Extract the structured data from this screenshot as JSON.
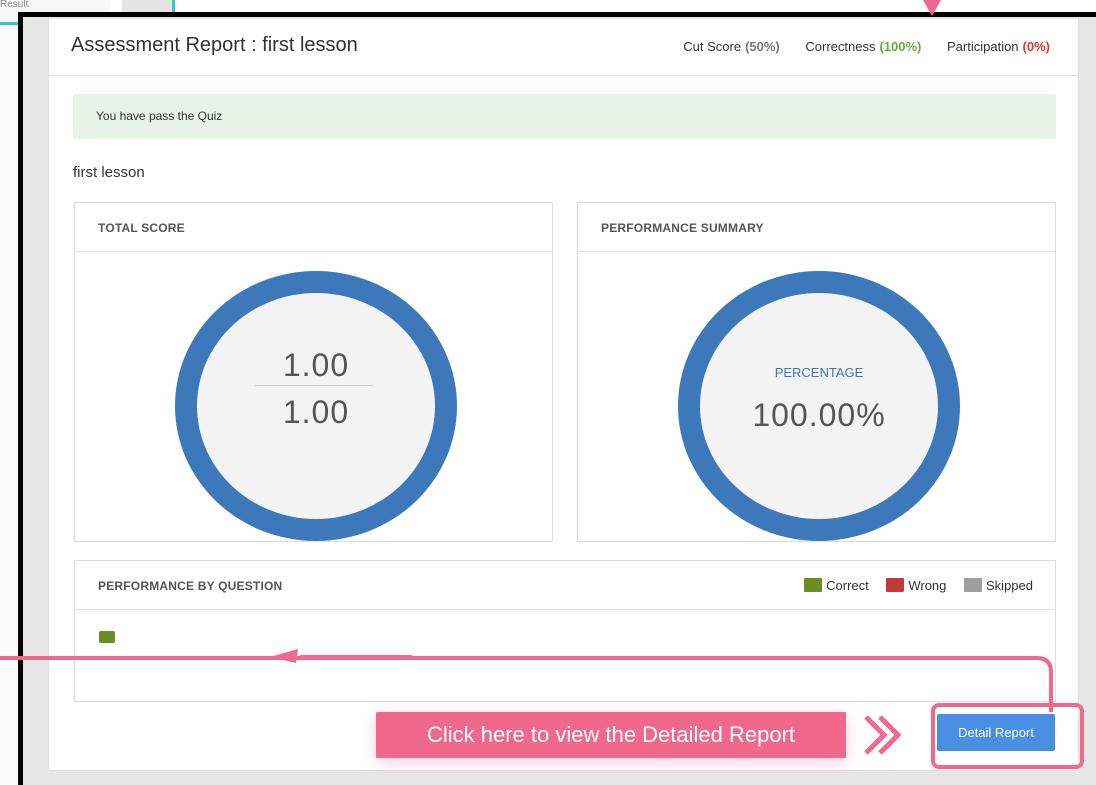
{
  "background": {
    "top_left_label": "Result"
  },
  "header": {
    "title": "Assessment Report : first lesson",
    "stats": [
      {
        "label": "Cut Score",
        "value": "(50%)"
      },
      {
        "label": "Correctness",
        "value": "(100%)"
      },
      {
        "label": "Participation",
        "value": "(0%)"
      }
    ]
  },
  "banner": {
    "message": "You have pass the Quiz"
  },
  "lesson": {
    "name": "first lesson"
  },
  "total_score": {
    "title": "TOTAL SCORE",
    "obtained": "1.00",
    "total": "1.00"
  },
  "performance_summary": {
    "title": "PERFORMANCE SUMMARY",
    "label": "PERCENTAGE",
    "value": "100.00%"
  },
  "performance_by_question": {
    "title": "PERFORMANCE BY QUESTION",
    "legend": [
      {
        "label": "Correct",
        "color": "#6b8e23"
      },
      {
        "label": "Wrong",
        "color": "#c0393b"
      },
      {
        "label": "Skipped",
        "color": "#9e9e9e"
      }
    ],
    "question_statuses": [
      "correct"
    ]
  },
  "actions": {
    "detail_report_label": "Detail Report"
  },
  "tutorial": {
    "callout_text": "Click here to view the Detailed Report",
    "highlight_color": "#f0688c"
  },
  "colors": {
    "ring": "#3d79ba",
    "button": "#4a90e2",
    "pass_banner": "#e6f3e6",
    "correct_value": "#6aa844",
    "participation_value": "#e0392f"
  }
}
